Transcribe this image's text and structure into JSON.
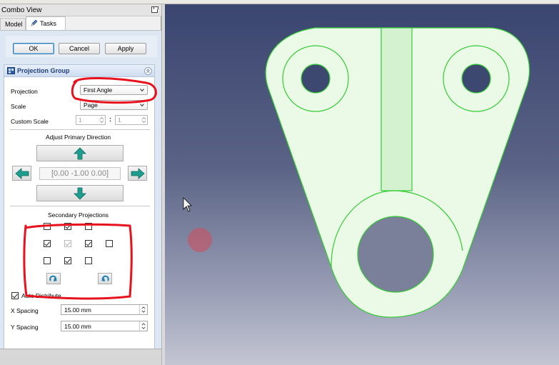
{
  "combo_view": {
    "title": "Combo View",
    "tabs": [
      {
        "label": "Model"
      },
      {
        "label": "Tasks"
      }
    ]
  },
  "dialog_buttons": {
    "ok": "OK",
    "cancel": "Cancel",
    "apply": "Apply"
  },
  "projection_group": {
    "title": "Projection Group",
    "projection_label": "Projection",
    "projection_value": "First Angle",
    "scale_label": "Scale",
    "scale_value": "Page",
    "custom_scale_label": "Custom Scale",
    "custom_scale_num": "1",
    "custom_scale_den": "1",
    "adjust_primary_direction_label": "Adjust Primary Direction",
    "primary_direction_value": "[0.00 -1.00 0.00]",
    "secondary_projections_label": "Secondary Projections",
    "secondary_projections": [
      {
        "row": 0,
        "col": 0,
        "checked": false,
        "enabled": true
      },
      {
        "row": 0,
        "col": 1,
        "checked": true,
        "enabled": true
      },
      {
        "row": 0,
        "col": 2,
        "checked": false,
        "enabled": true
      },
      {
        "row": 1,
        "col": 0,
        "checked": true,
        "enabled": true
      },
      {
        "row": 1,
        "col": 1,
        "checked": true,
        "enabled": false
      },
      {
        "row": 1,
        "col": 2,
        "checked": true,
        "enabled": true
      },
      {
        "row": 1,
        "col": 3,
        "checked": false,
        "enabled": true
      },
      {
        "row": 2,
        "col": 0,
        "checked": false,
        "enabled": true
      },
      {
        "row": 2,
        "col": 1,
        "checked": true,
        "enabled": true
      },
      {
        "row": 2,
        "col": 2,
        "checked": false,
        "enabled": true
      }
    ],
    "auto_distribute_label": "Auto Distribute",
    "auto_distribute_checked": true,
    "x_spacing_label": "X Spacing",
    "x_spacing_value": "15.00 mm",
    "y_spacing_label": "Y Spacing",
    "y_spacing_value": "15.00 mm"
  },
  "colors": {
    "part_fill": "#eafae6",
    "part_edge": "#33cc33",
    "annotation_red": "#e8121e",
    "viewport_top": "#3a4570",
    "viewport_bottom": "#c3c5d2"
  },
  "icons": [
    "pencil-icon",
    "projection-group-icon",
    "collapse-icon",
    "arrow-up-icon",
    "arrow-down-icon",
    "arrow-left-icon",
    "arrow-right-icon",
    "rotate-cw-icon",
    "rotate-ccw-icon",
    "mouse-cursor-icon"
  ]
}
